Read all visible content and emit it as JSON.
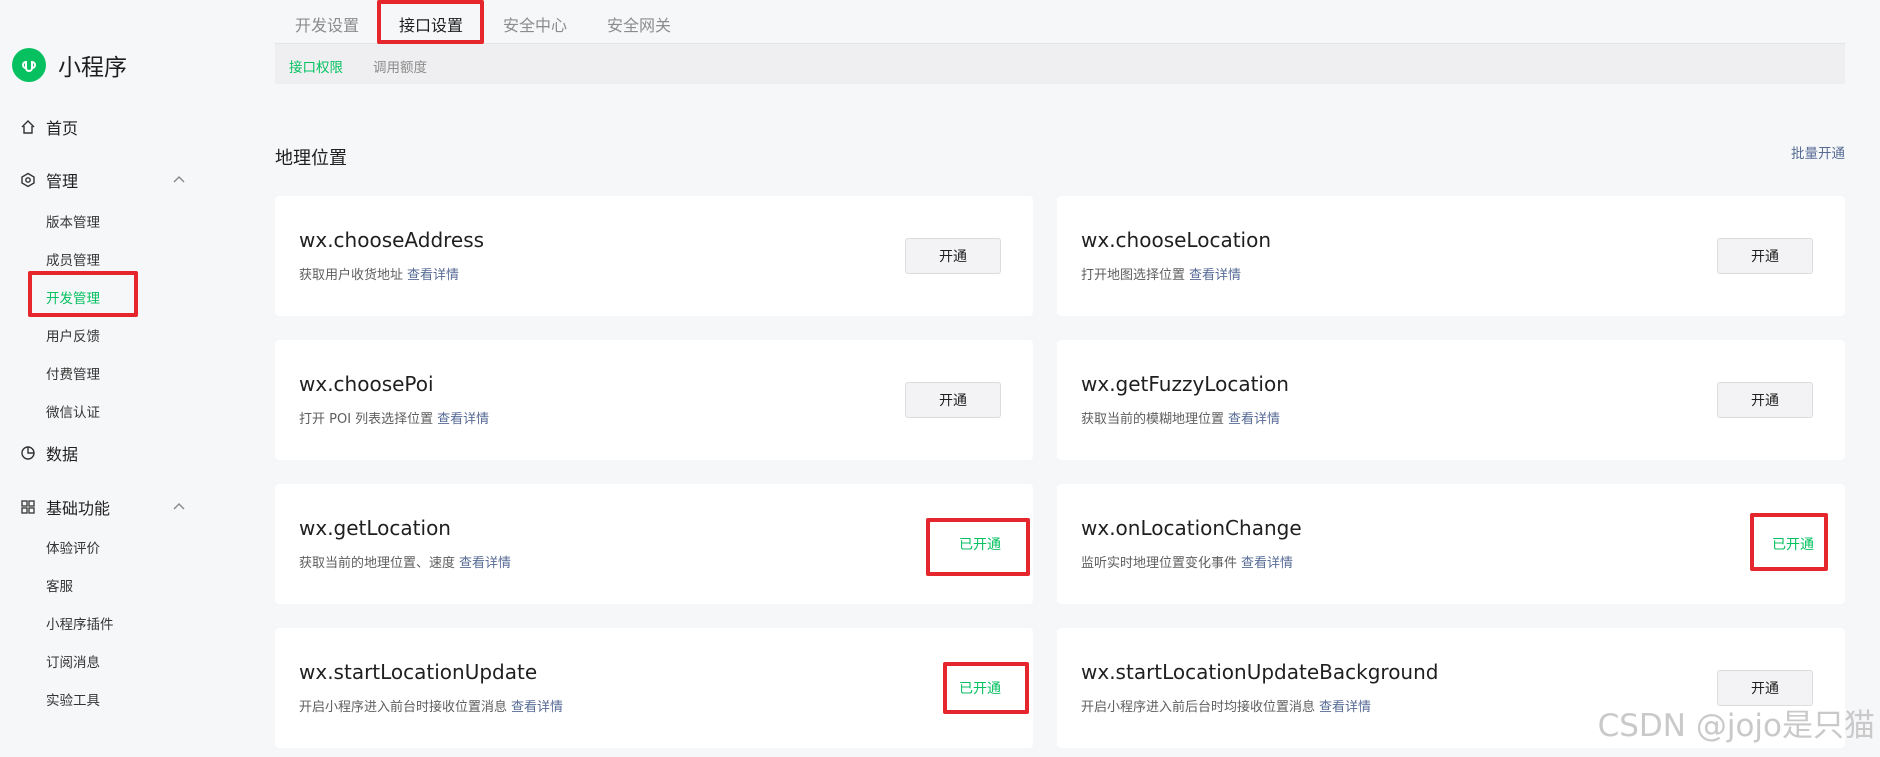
{
  "brand": {
    "name": "小程序",
    "color": "#07c160"
  },
  "sidebar": {
    "home": "首页",
    "manage": "管理",
    "manage_items": [
      "版本管理",
      "成员管理",
      "开发管理",
      "用户反馈",
      "付费管理",
      "微信认证"
    ],
    "data": "数据",
    "basic": "基础功能",
    "basic_items": [
      "体验评价",
      "客服",
      "小程序插件",
      "订阅消息",
      "实验工具"
    ]
  },
  "tabs": [
    "开发设置",
    "接口设置",
    "安全中心",
    "安全网关"
  ],
  "subtabs": [
    "接口权限",
    "调用额度"
  ],
  "section": {
    "title": "地理位置",
    "batch_action": "批量开通"
  },
  "link_text": "查看详情",
  "cards": [
    {
      "title": "wx.chooseAddress",
      "desc": "获取用户收货地址",
      "status": "开通"
    },
    {
      "title": "wx.chooseLocation",
      "desc": "打开地图选择位置",
      "status": "开通"
    },
    {
      "title": "wx.choosePoi",
      "desc": "打开 POI 列表选择位置",
      "status": "开通"
    },
    {
      "title": "wx.getFuzzyLocation",
      "desc": "获取当前的模糊地理位置",
      "status": "开通"
    },
    {
      "title": "wx.getLocation",
      "desc": "获取当前的地理位置、速度",
      "status": "已开通"
    },
    {
      "title": "wx.onLocationChange",
      "desc": "监听实时地理位置变化事件",
      "status": "已开通"
    },
    {
      "title": "wx.startLocationUpdate",
      "desc": "开启小程序进入前台时接收位置消息",
      "status": "已开通"
    },
    {
      "title": "wx.startLocationUpdateBackground",
      "desc": "开启小程序进入前后台时均接收位置消息",
      "status": "开通"
    }
  ],
  "watermark": "CSDN @jojo是只猫",
  "colors": {
    "accent": "#07c160",
    "link": "#576b95",
    "highlight": "#e5262c"
  }
}
